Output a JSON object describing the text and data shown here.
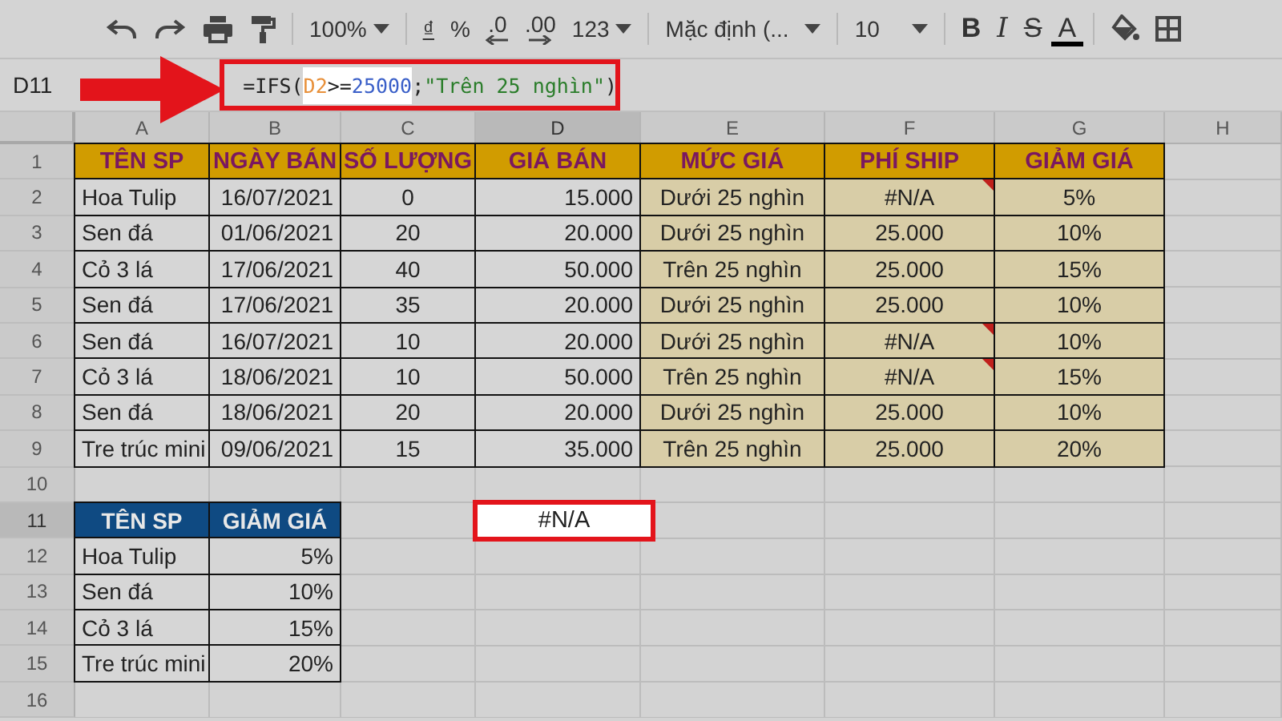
{
  "toolbar": {
    "zoom": "100%",
    "currency": "₫",
    "percent": "%",
    "decimal_decrease": ".0",
    "decimal_increase": ".00",
    "number_format": "123",
    "font": "Mặc định (...",
    "font_size": "10",
    "bold": "B",
    "italic": "I",
    "strikethrough": "S",
    "text_color": "A"
  },
  "formula_bar": {
    "name_box": "D11",
    "formula": [
      {
        "kind": "plain",
        "text": "=IFS(",
        "selected": false
      },
      {
        "kind": "ref",
        "text": "D2",
        "selected": true
      },
      {
        "kind": "plain",
        "text": ">=",
        "selected": true
      },
      {
        "kind": "number",
        "text": "25000",
        "selected": true
      },
      {
        "kind": "plain",
        "text": ";",
        "selected": false
      },
      {
        "kind": "string",
        "text": "\"Trên 25 nghìn\"",
        "selected": false
      },
      {
        "kind": "plain",
        "text": ")",
        "selected": false
      }
    ]
  },
  "sheet": {
    "columns": [
      {
        "label": "A",
        "selected": false
      },
      {
        "label": "B",
        "selected": false
      },
      {
        "label": "C",
        "selected": false
      },
      {
        "label": "D",
        "selected": true
      },
      {
        "label": "E",
        "selected": false
      },
      {
        "label": "F",
        "selected": false
      },
      {
        "label": "G",
        "selected": false
      },
      {
        "label": "H",
        "selected": false
      }
    ],
    "rows": [
      {
        "label": "1",
        "selected": false
      },
      {
        "label": "2",
        "selected": false
      },
      {
        "label": "3",
        "selected": false
      },
      {
        "label": "4",
        "selected": false
      },
      {
        "label": "5",
        "selected": false
      },
      {
        "label": "6",
        "selected": false
      },
      {
        "label": "7",
        "selected": false
      },
      {
        "label": "8",
        "selected": false
      },
      {
        "label": "9",
        "selected": false
      },
      {
        "label": "10",
        "selected": false
      },
      {
        "label": "11",
        "selected": true
      },
      {
        "label": "12",
        "selected": false
      },
      {
        "label": "13",
        "selected": false
      },
      {
        "label": "14",
        "selected": false
      },
      {
        "label": "15",
        "selected": false
      },
      {
        "label": "16",
        "selected": false
      }
    ]
  },
  "sales_table": {
    "columns": [
      "TÊN SP",
      "NGÀY BÁN",
      "SỐ LƯỢNG",
      "GIÁ BÁN",
      "MỨC GIÁ",
      "PHÍ SHIP",
      "GIẢM GIÁ"
    ],
    "rows": [
      {
        "cells": [
          "Hoa Tulip",
          "16/07/2021",
          "0",
          "15.000",
          "Dưới 25 nghìn",
          "#N/A",
          "5%"
        ],
        "flagged": true
      },
      {
        "cells": [
          "Sen đá",
          "01/06/2021",
          "20",
          "20.000",
          "Dưới 25 nghìn",
          "25.000",
          "10%"
        ],
        "flagged": false
      },
      {
        "cells": [
          "Cỏ 3 lá",
          "17/06/2021",
          "40",
          "50.000",
          "Trên 25 nghìn",
          "25.000",
          "15%"
        ],
        "flagged": false
      },
      {
        "cells": [
          "Sen đá",
          "17/06/2021",
          "35",
          "20.000",
          "Dưới 25 nghìn",
          "25.000",
          "10%"
        ],
        "flagged": false
      },
      {
        "cells": [
          "Sen đá",
          "16/07/2021",
          "10",
          "20.000",
          "Dưới 25 nghìn",
          "#N/A",
          "10%"
        ],
        "flagged": true
      },
      {
        "cells": [
          "Cỏ 3 lá",
          "18/06/2021",
          "10",
          "50.000",
          "Trên 25 nghìn",
          "#N/A",
          "15%"
        ],
        "flagged": true
      },
      {
        "cells": [
          "Sen đá",
          "18/06/2021",
          "20",
          "20.000",
          "Dưới 25 nghìn",
          "25.000",
          "10%"
        ],
        "flagged": false
      },
      {
        "cells": [
          "Tre trúc mini",
          "09/06/2021",
          "15",
          "35.000",
          "Trên 25 nghìn",
          "25.000",
          "20%"
        ],
        "flagged": false
      }
    ]
  },
  "discount_table": {
    "columns": [
      "TÊN SP",
      "GIẢM GIÁ"
    ],
    "rows": [
      [
        "Hoa Tulip",
        "5%"
      ],
      [
        "Sen đá",
        "10%"
      ],
      [
        "Cỏ 3 lá",
        "15%"
      ],
      [
        "Tre trúc mini",
        "20%"
      ]
    ]
  },
  "active_cell": {
    "value": "#N/A"
  }
}
